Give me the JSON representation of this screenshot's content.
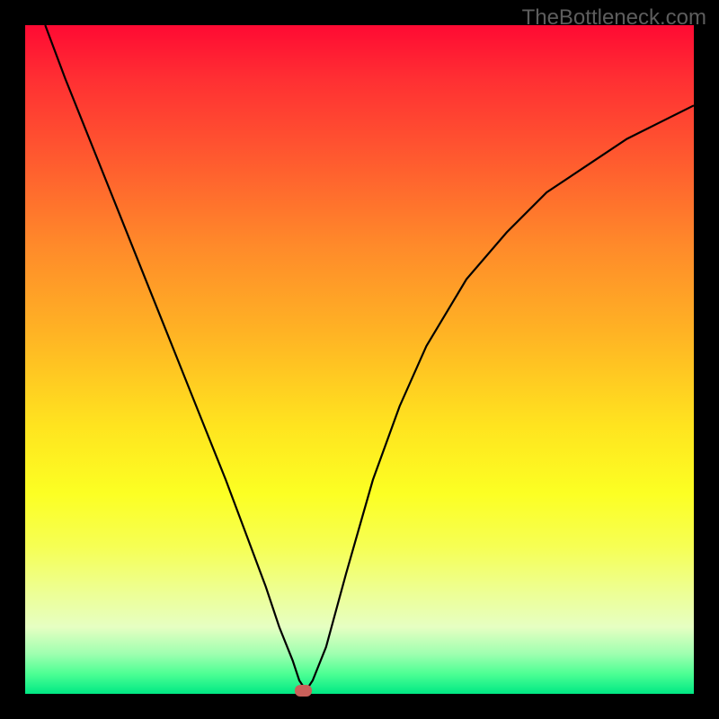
{
  "watermark": "TheBottleneck.com",
  "chart_data": {
    "type": "line",
    "title": "",
    "xlabel": "",
    "ylabel": "",
    "xlim": [
      0,
      100
    ],
    "ylim": [
      0,
      100
    ],
    "grid": false,
    "legend": false,
    "series": [
      {
        "name": "bottleneck-curve",
        "x": [
          3,
          6,
          10,
          14,
          18,
          22,
          26,
          30,
          33,
          36,
          38,
          40,
          41,
          42,
          43,
          45,
          48,
          52,
          56,
          60,
          66,
          72,
          78,
          84,
          90,
          96,
          100
        ],
        "y": [
          100,
          92,
          82,
          72,
          62,
          52,
          42,
          32,
          24,
          16,
          10,
          5,
          2,
          0.5,
          2,
          7,
          18,
          32,
          43,
          52,
          62,
          69,
          75,
          79,
          83,
          86,
          88
        ]
      }
    ],
    "marker": {
      "name": "optimum-point",
      "x": 41.5,
      "y": 0.5,
      "color": "#c9605a"
    },
    "gradient_meaning": "vertical gradient — top red (high bottleneck), bottom green (low bottleneck)"
  }
}
